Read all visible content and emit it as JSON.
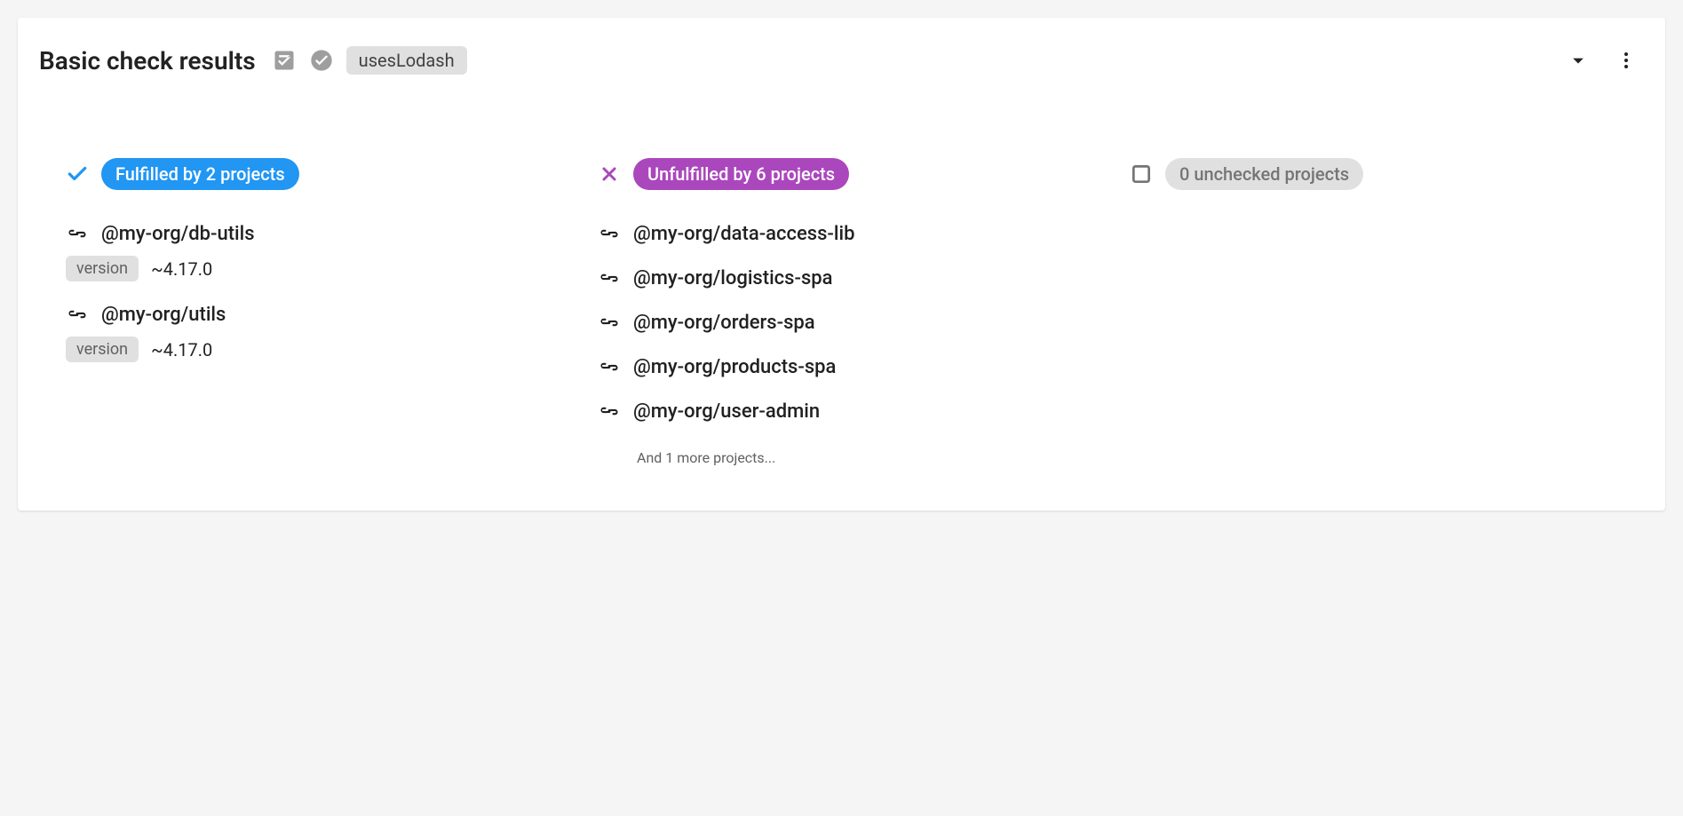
{
  "header": {
    "title": "Basic check results",
    "tag": "usesLodash"
  },
  "columns": {
    "fulfilled": {
      "badge": "Fulfilled by 2 projects",
      "projects": [
        {
          "name": "@my-org/db-utils",
          "version_label": "version",
          "version": "~4.17.0"
        },
        {
          "name": "@my-org/utils",
          "version_label": "version",
          "version": "~4.17.0"
        }
      ]
    },
    "unfulfilled": {
      "badge": "Unfulfilled by 6 projects",
      "projects": [
        {
          "name": "@my-org/data-access-lib"
        },
        {
          "name": "@my-org/logistics-spa"
        },
        {
          "name": "@my-org/orders-spa"
        },
        {
          "name": "@my-org/products-spa"
        },
        {
          "name": "@my-org/user-admin"
        }
      ],
      "more": "And 1 more projects..."
    },
    "unchecked": {
      "badge": "0 unchecked projects"
    }
  }
}
